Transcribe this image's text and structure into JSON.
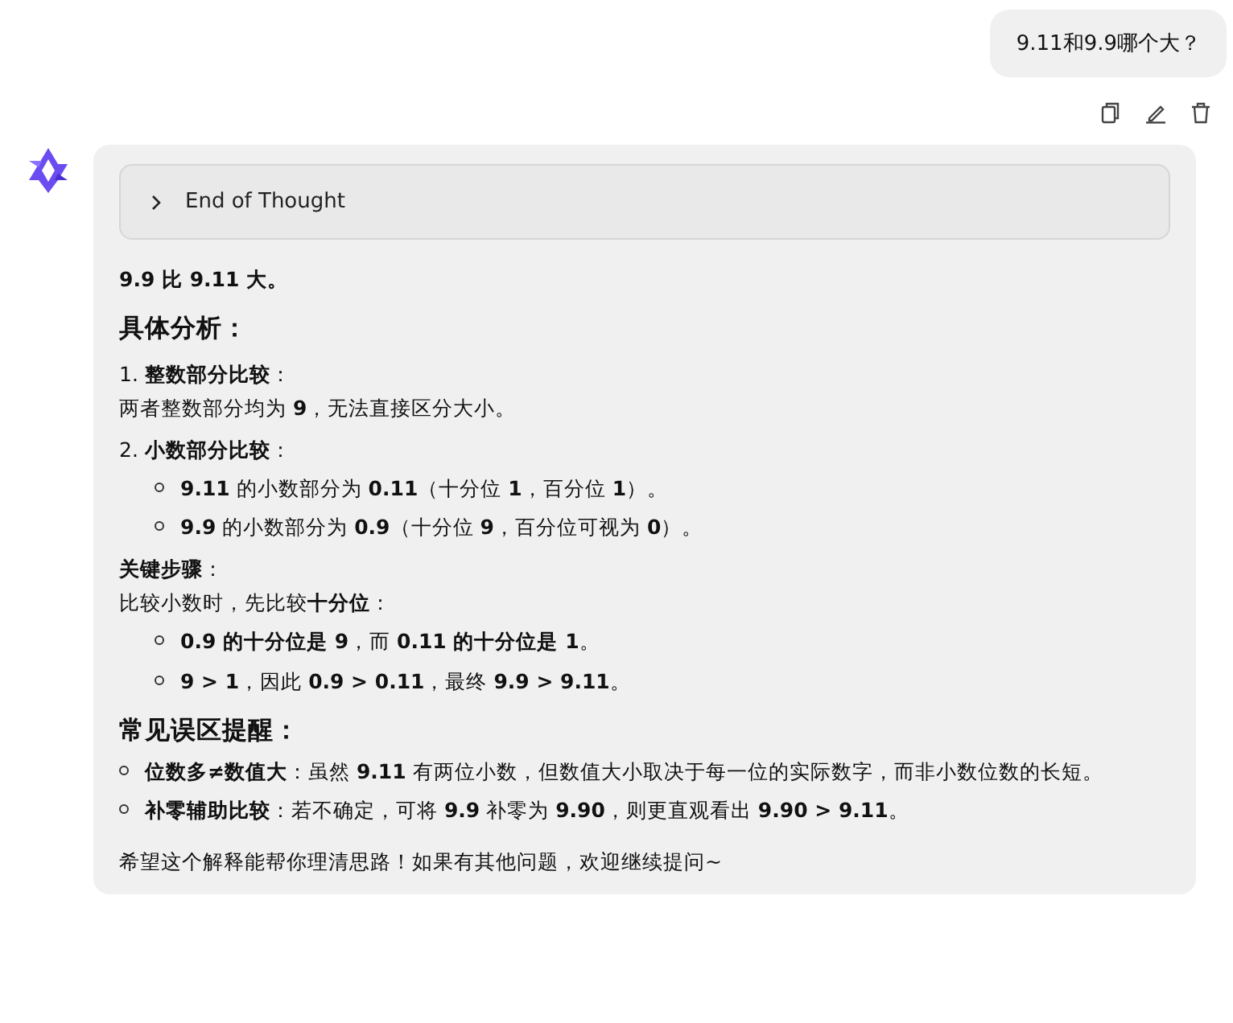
{
  "user_message": {
    "text": "9.11和9.9哪个大？"
  },
  "message_actions": [
    {
      "kind": "copy"
    },
    {
      "kind": "edit"
    },
    {
      "kind": "delete"
    }
  ],
  "reply": {
    "thought": {
      "label": "End of Thought",
      "expanded": false
    },
    "blocks": [
      {
        "kind": "lead",
        "text": "9.9 比 9.11 大。"
      },
      {
        "kind": "heading",
        "text": "具体分析："
      },
      {
        "kind": "label",
        "text": "1. **整数部分比较**："
      },
      {
        "kind": "paragraph",
        "text": "两者整数部分均为 **9**，无法直接区分大小。"
      },
      {
        "kind": "label",
        "text": "2. **小数部分比较**："
      },
      {
        "kind": "sublist",
        "items": [
          "**9.11** 的小数部分为 **0.11**（十分位 **1**，百分位 **1**）。",
          "**9.9** 的小数部分为 **0.9**（十分位 **9**，百分位可视为 **0**）。"
        ]
      },
      {
        "kind": "label",
        "text": "**关键步骤**："
      },
      {
        "kind": "paragraph",
        "text": "比较小数时，先比较**十分位**："
      },
      {
        "kind": "sublist",
        "items": [
          "**0.9 的十分位是 9**，而 **0.11 的十分位是 1**。",
          "**9 > 1**，因此 **0.9 > 0.11**，最终 **9.9 > 9.11**。"
        ]
      },
      {
        "kind": "heading",
        "text": "常见误区提醒："
      },
      {
        "kind": "list",
        "items": [
          "**位数多≠数值大**：虽然 **9.11** 有两位小数，但数值大小取决于每一位的实际数字，而非小数位数的长短。",
          "**补零辅助比较**：若不确定，可将 **9.9** 补零为 **9.90**，则更直观看出 **9.90 > 9.11**。"
        ]
      },
      {
        "kind": "closing",
        "text": "希望这个解释能帮你理清思路！如果有其他问题，欢迎继续提问~"
      }
    ]
  }
}
